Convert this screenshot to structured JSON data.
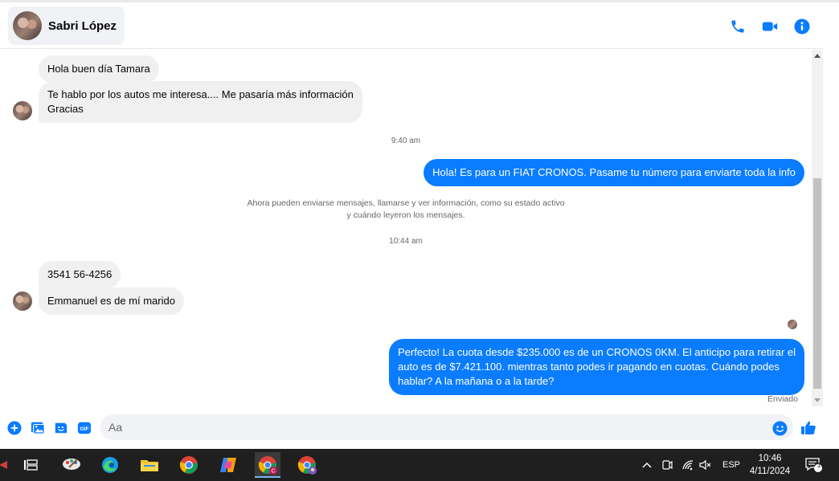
{
  "header": {
    "contact_name": "Sabri López"
  },
  "messages": {
    "m1": "Hola buen día Tamara",
    "m2_line1": "Te hablo por los autos me interesa.... Me pasaría más información",
    "m2_line2": "Gracias",
    "time1": "9:40 am",
    "m3": "Hola! Es para un FIAT CRONOS. Pasame tu número para enviarte toda la info",
    "system_line1": "Ahora pueden enviarse mensajes, llamarse y ver información, como su estado activo",
    "system_line2": "y cuándo leyeron los mensajes.",
    "time2": "10:44 am",
    "m4": "3541 56-4256",
    "m5": "Emmanuel es de mí marido",
    "m6_line1": "Perfecto! La cuota desde $235.000 es de un CRONOS 0KM. El anticipo para retirar el",
    "m6_line2": "auto es de $7.421.100. mientras tanto podes ir pagando en cuotas. Cuándo podes",
    "m6_line3": "hablar? A la mañana o a la tarde?",
    "status": "Enviado"
  },
  "composer": {
    "placeholder": "Aa"
  },
  "taskbar": {
    "language": "ESP",
    "time": "10:46",
    "date": "4/11/2024",
    "notification_count": "1"
  },
  "colors": {
    "accent": "#0a7cff",
    "incoming_bubble": "#f0f0f0",
    "taskbar": "#1f1f1f"
  }
}
